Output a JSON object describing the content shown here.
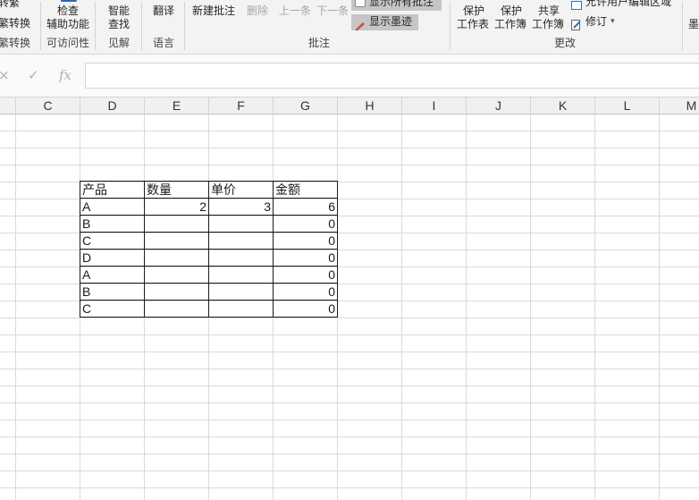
{
  "ribbon": {
    "groups": {
      "chinese_conversion": {
        "top_label": "转繁",
        "button_label": "繁转换",
        "group_label": "繁转换"
      },
      "accessibility": {
        "button_line1": "检查",
        "button_line2": "辅助功能",
        "group_label": "可访问性"
      },
      "insights": {
        "button_line1": "智能",
        "button_line2": "查找",
        "group_label": "见解"
      },
      "language": {
        "button_label": "翻译",
        "group_label": "语言"
      },
      "comments": {
        "new_comment": "新建批注",
        "delete": "删除",
        "previous": "上一条",
        "next": "下一条",
        "show_all": "显示所有批注",
        "show_ink": "显示墨迹",
        "group_label": "批注"
      },
      "changes": {
        "protect_sheet_line1": "保护",
        "protect_sheet_line2": "工作表",
        "protect_workbook_line1": "保护",
        "protect_workbook_line2": "工作簿",
        "share_workbook_line1": "共享",
        "share_workbook_line2": "工作簿",
        "allow_edit_ranges": "允许用户编辑区域",
        "track_changes": "修订",
        "group_label": "更改"
      },
      "partial": {
        "label": "墨"
      }
    }
  },
  "formula_bar": {
    "cancel_icon": "×",
    "enter_icon": "✓",
    "fx_label": "fx",
    "value": ""
  },
  "columns": [
    "C",
    "D",
    "E",
    "F",
    "G",
    "H",
    "I",
    "J",
    "K",
    "L",
    "M"
  ],
  "table": {
    "headers": [
      "产品",
      "数量",
      "单价",
      "金额"
    ],
    "rows": [
      [
        "A",
        "2",
        "3",
        "6"
      ],
      [
        "B",
        "",
        "",
        "0"
      ],
      [
        "C",
        "",
        "",
        "0"
      ],
      [
        "D",
        "",
        "",
        "0"
      ],
      [
        "A",
        "",
        "",
        "0"
      ],
      [
        "B",
        "",
        "",
        "0"
      ],
      [
        "C",
        "",
        "",
        "0"
      ]
    ]
  }
}
